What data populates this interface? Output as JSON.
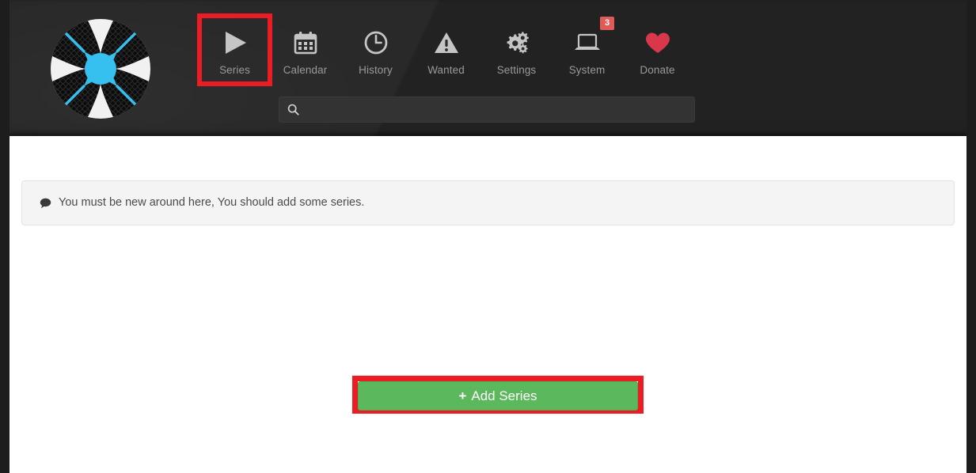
{
  "app": {
    "name": "Sonarr",
    "logo_icon": "sonarr-logo-icon",
    "colors": {
      "header_bg": "#262626",
      "page_bg": "#1d1d1d",
      "panel_bg": "#ffffff",
      "accent_blue": "#35c0f0",
      "highlight_red": "#ec1c24",
      "button_green": "#5cb85c",
      "badge_red": "#de5b57",
      "donate_red": "#d9384b",
      "nav_label": "#9a9a9a",
      "alert_bg": "#f4f4f4"
    }
  },
  "nav": {
    "items": [
      {
        "label": "Series",
        "icon": "play-triangle-icon",
        "highlighted": true,
        "badge": null
      },
      {
        "label": "Calendar",
        "icon": "calendar-icon",
        "highlighted": false,
        "badge": null
      },
      {
        "label": "History",
        "icon": "clock-icon",
        "highlighted": false,
        "badge": null
      },
      {
        "label": "Wanted",
        "icon": "warning-triangle-icon",
        "highlighted": false,
        "badge": null
      },
      {
        "label": "Settings",
        "icon": "gears-icon",
        "highlighted": false,
        "badge": null
      },
      {
        "label": "System",
        "icon": "laptop-icon",
        "highlighted": false,
        "badge": "3"
      },
      {
        "label": "Donate",
        "icon": "heart-icon",
        "highlighted": false,
        "badge": null
      }
    ]
  },
  "search": {
    "icon": "search-icon",
    "value": "",
    "placeholder": ""
  },
  "main": {
    "alert": {
      "icon": "comment-bubble-icon",
      "message": "You must be new around here, You should add some series."
    },
    "add_series_button": {
      "icon": "plus-icon",
      "plus": "+",
      "label": "Add Series",
      "highlighted": true
    }
  }
}
